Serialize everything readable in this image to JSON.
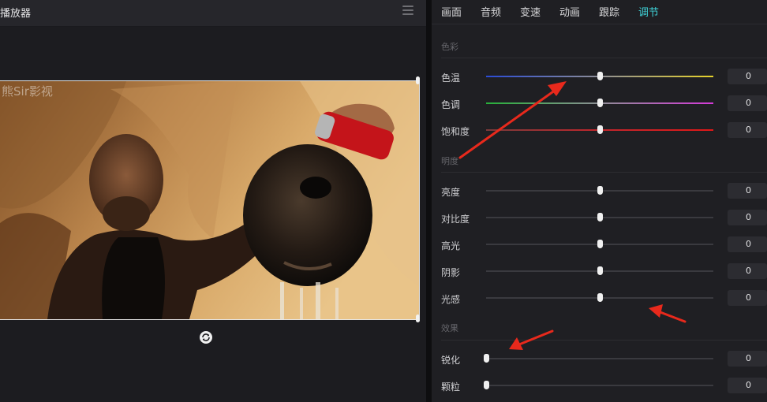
{
  "player": {
    "title": "播放器",
    "watermark": "熊Sir影视"
  },
  "tabs": [
    {
      "label": "画面"
    },
    {
      "label": "音频"
    },
    {
      "label": "变速"
    },
    {
      "label": "动画"
    },
    {
      "label": "跟踪"
    },
    {
      "label": "调节",
      "active": true
    }
  ],
  "sections": {
    "color": "色彩",
    "light": "明度",
    "effects": "效果"
  },
  "sliders": [
    {
      "label": "色温",
      "value": "0",
      "level": 0.5
    },
    {
      "label": "色调",
      "value": "0",
      "level": 0.5
    },
    {
      "label": "饱和度",
      "value": "0",
      "level": 0.5
    },
    {
      "label": "亮度",
      "value": "0",
      "level": 0.5
    },
    {
      "label": "对比度",
      "value": "0",
      "level": 0.5
    },
    {
      "label": "高光",
      "value": "0",
      "level": 0.5
    },
    {
      "label": "阴影",
      "value": "0",
      "level": 0.5
    },
    {
      "label": "光感",
      "value": "0",
      "level": 0.5
    },
    {
      "label": "锐化",
      "value": "0",
      "level": 0.0
    },
    {
      "label": "颗粒",
      "value": "0",
      "level": 0.0
    }
  ],
  "colors": {
    "accent": "#3fd3d8",
    "annotation": "#e8291c"
  },
  "icons": {
    "menu": "menu-icon",
    "reset": "reset-icon"
  }
}
